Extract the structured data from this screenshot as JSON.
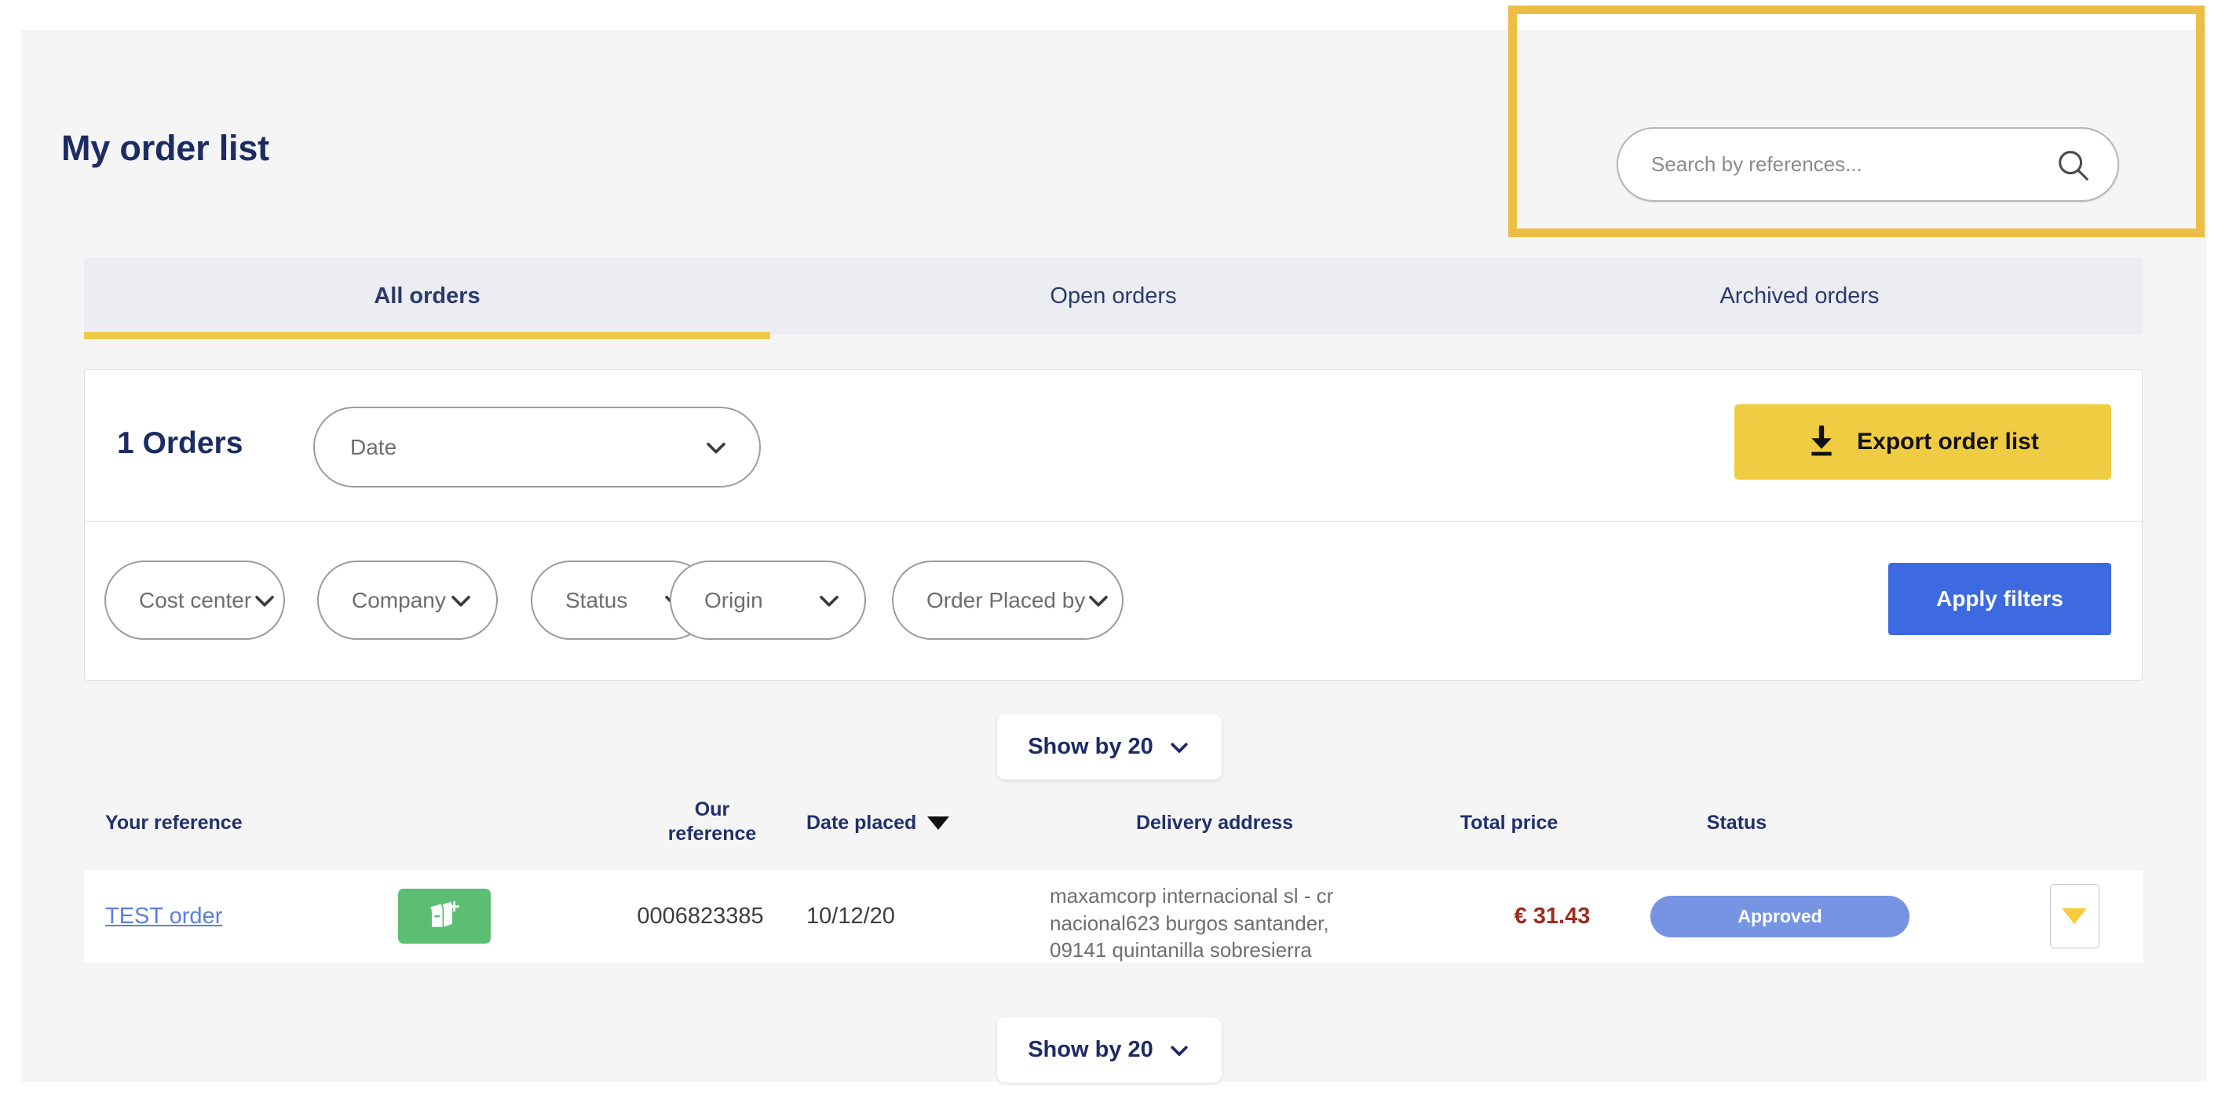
{
  "header": {
    "title": "My order list",
    "search": {
      "placeholder": "Search by references...",
      "value": "",
      "icon": "search-icon"
    },
    "highlight_color": "#ecbe45"
  },
  "tabs": [
    {
      "label": "All orders",
      "active": true
    },
    {
      "label": "Open orders",
      "active": false
    },
    {
      "label": "Archived orders",
      "active": false
    }
  ],
  "toolbar": {
    "orders_count": "1 Orders",
    "sort_select": {
      "label": "Date",
      "icon": "chevron-down-icon"
    },
    "export_label": "Export order list",
    "export_icon": "download-icon",
    "export_color": "#f0cc42"
  },
  "filters": {
    "selects": [
      {
        "label": "Cost center"
      },
      {
        "label": "Company"
      },
      {
        "label": "Status"
      },
      {
        "label": "Origin"
      },
      {
        "label": "Order Placed by"
      }
    ],
    "apply_label": "Apply filters",
    "apply_color": "#3d6ae0"
  },
  "pagination": {
    "top_label": "Show by 20",
    "bottom_label": "Show by 20",
    "icon": "chevron-down-icon"
  },
  "table": {
    "headers": {
      "your_reference": "Your reference",
      "our_reference_line1": "Our",
      "our_reference_line2": "reference",
      "date_placed": "Date placed",
      "delivery_address": "Delivery address",
      "total_price": "Total price",
      "status": "Status"
    },
    "sort_indicator": "sort-desc-caret",
    "rows": [
      {
        "your_reference": "TEST order",
        "reorder_icon": "add-to-cart-box-icon",
        "reorder_color": "#5cbe72",
        "our_reference": "0006823385",
        "date_placed": "10/12/20",
        "delivery_address_line1": "maxamcorp internacional sl - cr",
        "delivery_address_line2": "nacional623 burgos santander,",
        "delivery_address_line3": "09141 quintanilla sobresierra",
        "total_price": "€ 31.43",
        "status": "Approved",
        "status_color": "#7794e3",
        "expand_icon": "caret-down-icon"
      }
    ]
  }
}
